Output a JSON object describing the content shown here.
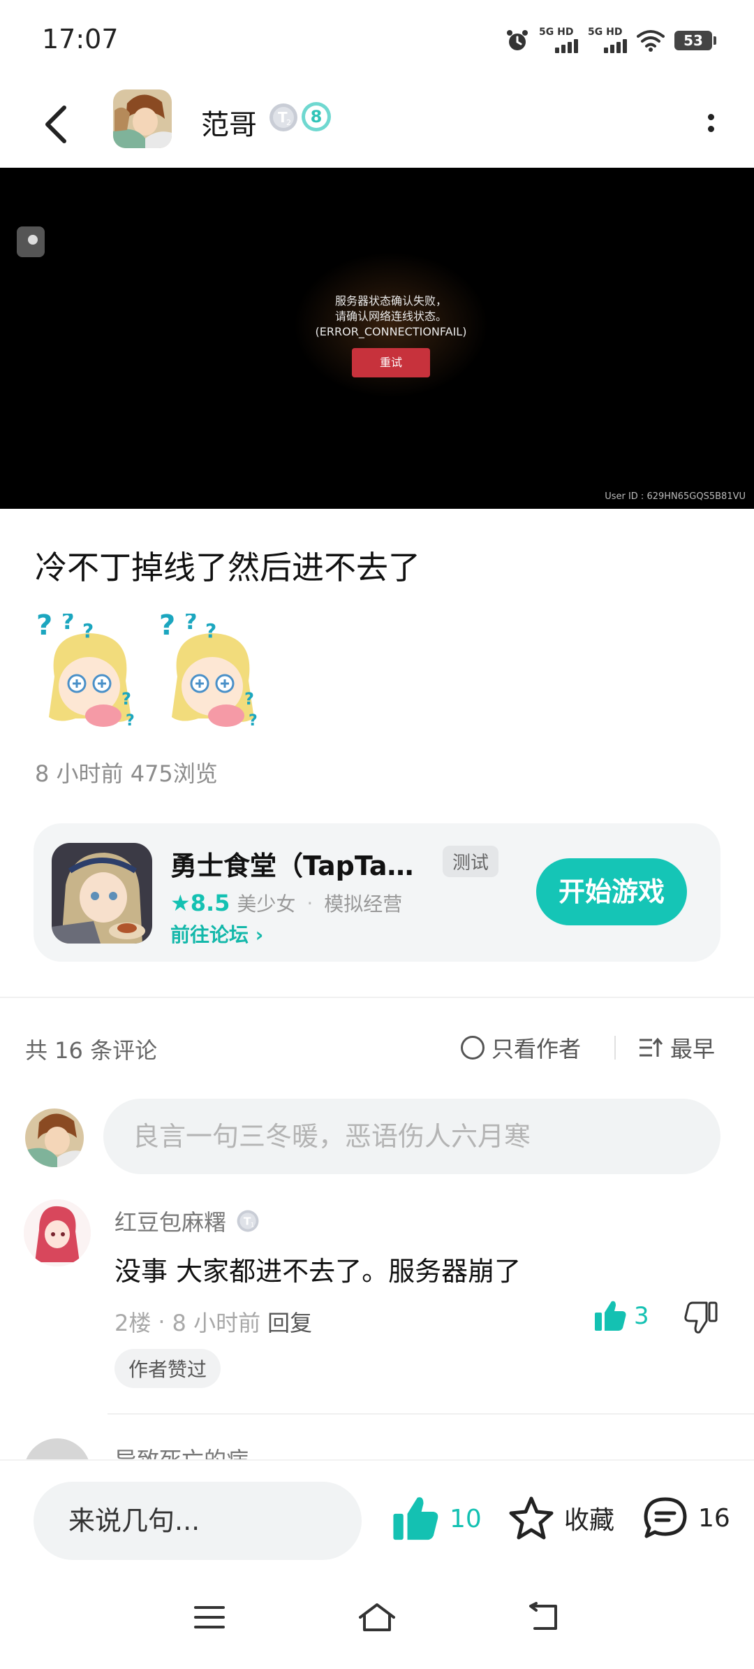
{
  "status_bar": {
    "time": "17:07",
    "signal1_label": "5G HD",
    "signal2_label": "5G HD",
    "battery": "53"
  },
  "header": {
    "author_name": "范哥",
    "badge_level": "8",
    "avatar_icon": "author-avatar",
    "back_icon": "back-arrow-icon",
    "more_icon": "more-vertical-icon"
  },
  "post_image": {
    "error_line1": "服务器状态确认失败，",
    "error_line2": "请确认网络连线状态。",
    "error_line3": "(ERROR_CONNECTIONFAIL)",
    "retry_label": "重试",
    "user_id": "User ID : 629HN65GQS5B81VU"
  },
  "post": {
    "title": "冷不丁掉线了然后进不去了",
    "meta": "8 小时前  475浏览"
  },
  "game_card": {
    "name": "勇士食堂（TapTa…",
    "tag": "测试",
    "rating": "★8.5",
    "genre1": "美少女",
    "separator": "·",
    "genre2": "模拟经营",
    "forum_link": "前往论坛 ›",
    "play_label": "开始游戏",
    "accent_color": "#15c5b6"
  },
  "comments_header": {
    "count_label": "共 16 条评论",
    "only_author_label": "只看作者",
    "sort_label": "最早"
  },
  "comment_input": {
    "placeholder": "良言一句三冬暖，恶语伤人六月寒"
  },
  "comments": [
    {
      "name": "红豆包麻糬",
      "text": "没事 大家都进不去了。服务器崩了",
      "floor": "2楼",
      "dot": "·",
      "time": "8 小时前",
      "reply_label": "回复",
      "likes": "3",
      "author_liked": "作者赞过"
    },
    {
      "name": "导致死亡的病"
    }
  ],
  "bottom_bar": {
    "say_placeholder": "来说几句...",
    "like_count": "10",
    "fav_label": "收藏",
    "comment_count": "16"
  }
}
